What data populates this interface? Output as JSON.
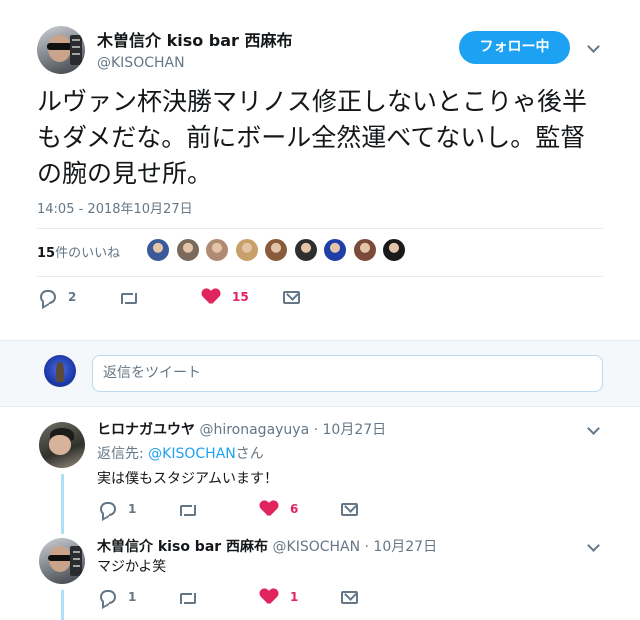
{
  "tweet": {
    "author_name": "木曽信介 kiso bar 西麻布",
    "author_handle": "@KISOCHAN",
    "follow_label": "フォロー中",
    "text": "ルヴァン杯決勝マリノス修正しないとこりゃ後半もダメだな。前にボール全然運べてないし。監督の腕の見せ所。",
    "timestamp": "14:05 - 2018年10月27日",
    "likes_count": "15",
    "likes_label": "件のいいね",
    "reply_count": "2",
    "like_count_action": "15",
    "liker_colors": [
      "#3b5a9a",
      "#7a6a5c",
      "#b08a72",
      "#c7a06a",
      "#8a5a3c",
      "#2e2e2e",
      "#1e3ea8",
      "#7b4a3a",
      "#1a1a1a"
    ]
  },
  "reply_box": {
    "placeholder": "返信をツイート"
  },
  "replies": [
    {
      "name": "ヒロナガユウヤ",
      "meta": "@hironagayuya · 10月27日",
      "reply_to_prefix": "返信先: ",
      "reply_to_mention": "@KISOCHAN",
      "reply_to_suffix": "さん",
      "text": "実は僕もスタジアムいます！",
      "reply_count": "1",
      "like_count": "6"
    },
    {
      "name": "木曽信介 kiso bar 西麻布",
      "meta": "@KISOCHAN · 10月27日",
      "text": "マジかよ笑",
      "reply_count": "1",
      "like_count": "1"
    }
  ],
  "colors": {
    "brand_blue": "#1da1f2",
    "like_red": "#e0245e",
    "muted": "#657786",
    "thread_line": "#b3dcf7"
  },
  "icons": [
    "reply-icon",
    "retweet-icon",
    "heart-icon",
    "direct-message-icon",
    "chevron-down-icon"
  ]
}
